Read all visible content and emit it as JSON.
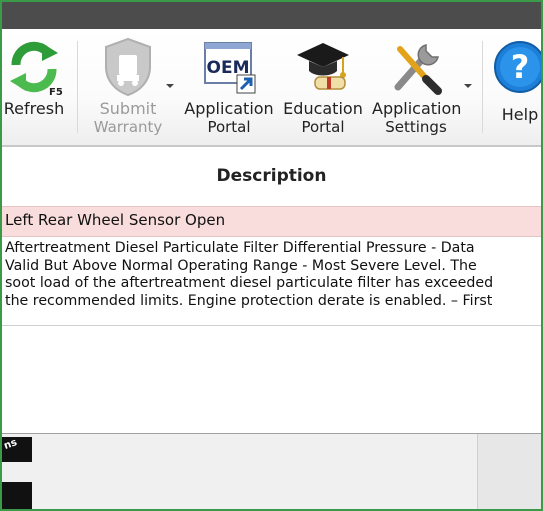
{
  "toolbar": {
    "refresh": {
      "label": "Refresh",
      "shortcut": "F5"
    },
    "submit_warranty": {
      "line1": "Submit",
      "line2": "Warranty"
    },
    "application_portal": {
      "line1": "Application",
      "line2": "Portal",
      "icon_text": "OEM"
    },
    "education_portal": {
      "line1": "Education",
      "line2": "Portal"
    },
    "application_settings": {
      "line1": "Application",
      "line2": "Settings"
    },
    "help": {
      "label": "Help"
    }
  },
  "grid": {
    "column_header": "Description",
    "rows": [
      {
        "text": "Left Rear Wheel Sensor Open"
      },
      {
        "text": "Aftertreatment Diesel Particulate Filter Differential Pressure - Data\nValid But Above Normal Operating Range - Most Severe Level. The\nsoot load of the aftertreatment diesel particulate filter has exceeded\nthe recommended limits. Engine protection derate is enabled. – First"
      }
    ]
  },
  "bottom": {
    "fragment": "ns"
  },
  "colors": {
    "frame_border": "#3a9a48",
    "titlebar": "#4c4c4c",
    "highlight_row": "#f9dcdc",
    "help_icon": "#1d7fd8"
  }
}
